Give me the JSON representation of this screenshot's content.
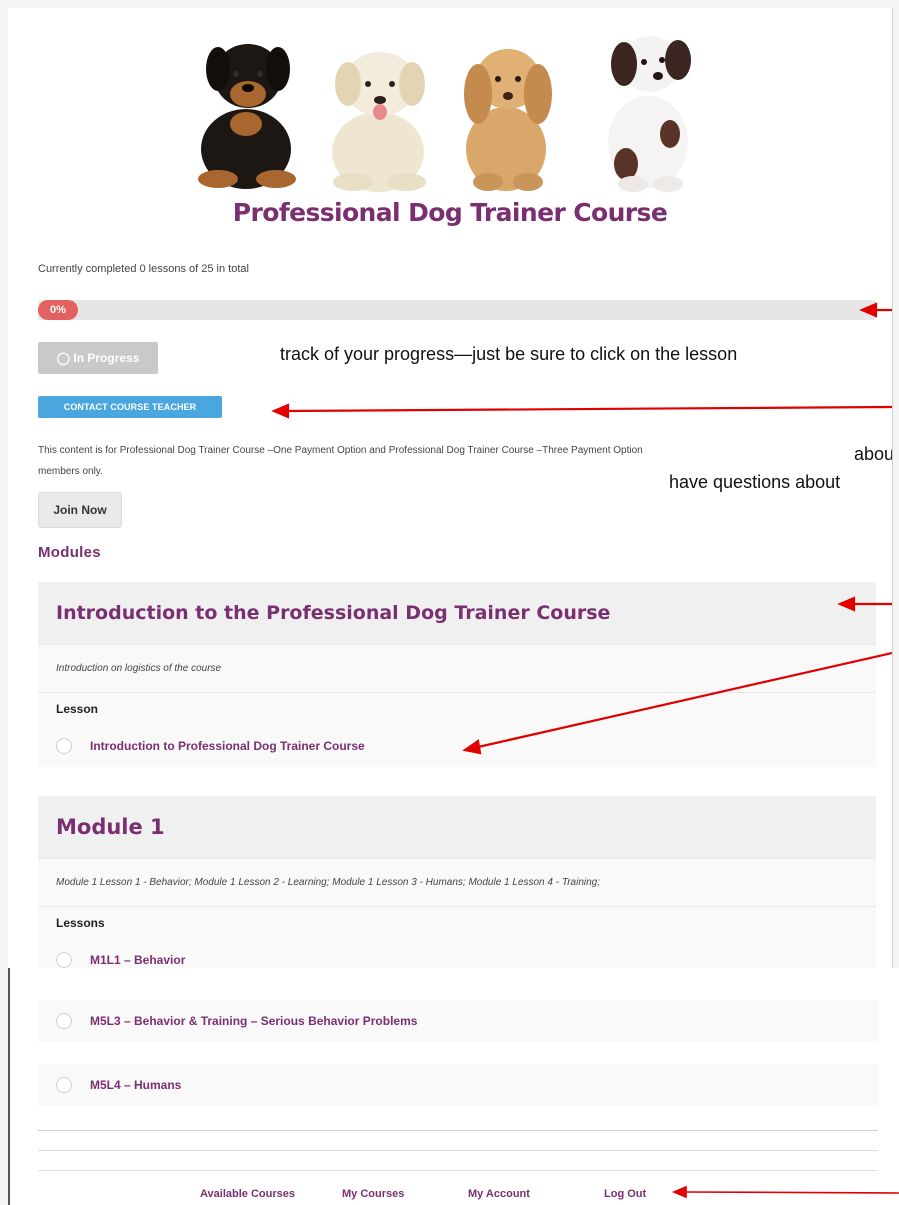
{
  "brand": {
    "title": "Professional Dog Trainer Course"
  },
  "progress": {
    "summary": "Currently completed 0 lessons of 25 in total",
    "percent_label": "0%",
    "percent": 0,
    "status_label": "In Progress"
  },
  "overlay_text": {
    "line1": "track of your progress—just be sure to click on the lesson",
    "line2": "abou",
    "line3": "have questions about"
  },
  "contact_button": "CONTACT COURSE TEACHER",
  "membership_notice": "This content is for Professional Dog Trainer Course –One Payment Option and Professional Dog Trainer Course –Three Payment Option",
  "membership_notice_2": "members only.",
  "join_button": "Join Now",
  "modules_heading": "Modules",
  "modules": [
    {
      "title": "Introduction to the Professional Dog Trainer Course",
      "description": "Introduction on logistics of the course",
      "lessons_label": "Lesson",
      "lessons": [
        "Introduction to Professional Dog Trainer Course"
      ]
    },
    {
      "title": "Module 1",
      "description": "Module 1 Lesson 1 - Behavior; Module 1 Lesson 2 - Learning; Module 1 Lesson 3 - Humans; Module 1 Lesson 4 - Training;",
      "lessons_label": "Lessons",
      "lessons": [
        "M1L1 – Behavior"
      ]
    }
  ],
  "later_lessons": [
    "M5L3 – Behavior & Training – Serious Behavior Problems",
    "M5L4 – Humans"
  ],
  "footer": {
    "links": [
      "Available Courses",
      "My Courses",
      "My Account",
      "Log Out"
    ]
  },
  "colors": {
    "accent": "#7a2f71",
    "progress_pill": "#e46161",
    "contact_button": "#4aa6df",
    "annotation_arrow": "#e00000"
  }
}
